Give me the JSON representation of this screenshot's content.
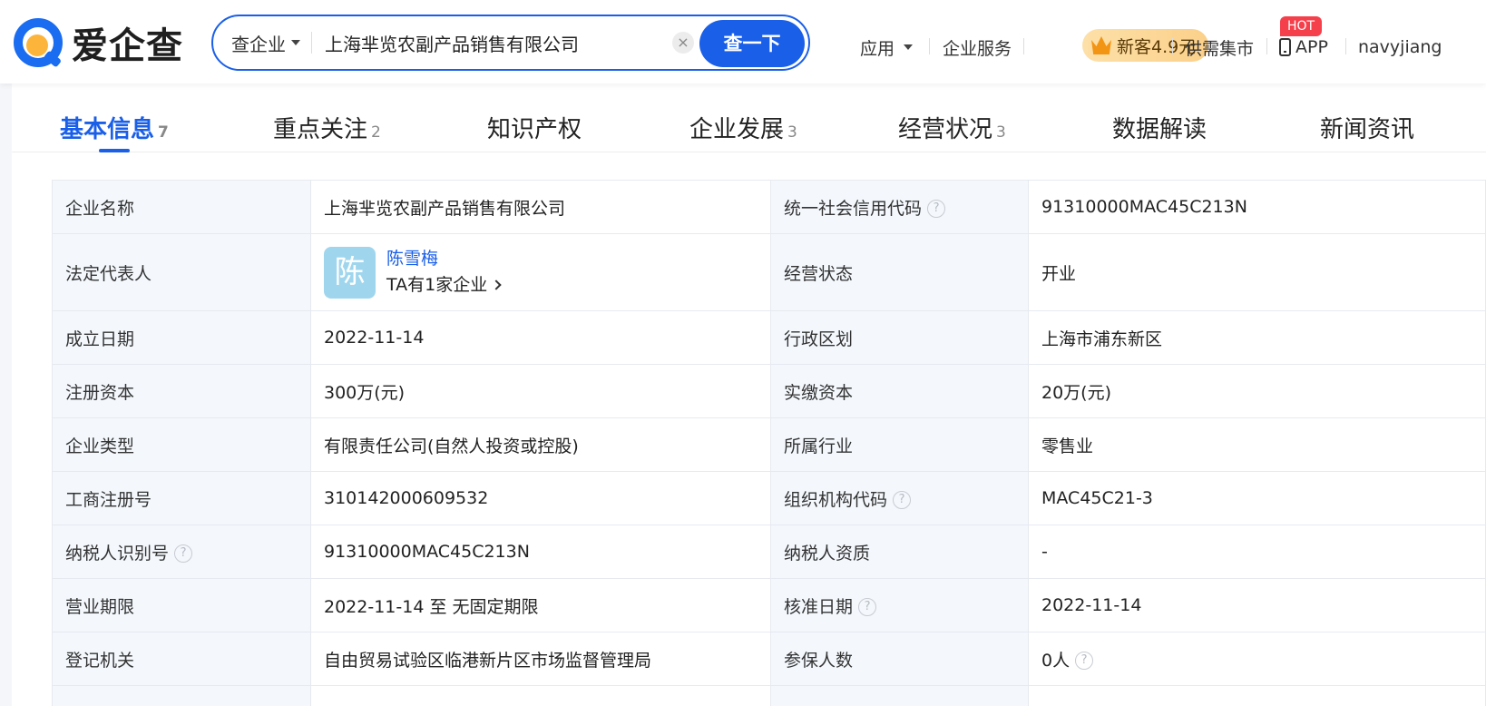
{
  "header": {
    "logo_text": "爱企查",
    "search": {
      "type_label": "查企业",
      "query": "上海芈览农副产品销售有限公司",
      "clear": "×",
      "button": "查一下"
    },
    "nav": {
      "apps": "应用",
      "enterprise_services": "企业服务",
      "vip_promo": "新客4.9元",
      "supply_market": "供需集市",
      "hot_badge": "HOT",
      "app": "APP",
      "user": "navyjiang"
    }
  },
  "tabs": [
    {
      "label": "基本信息",
      "count": "7",
      "active": true
    },
    {
      "label": "重点关注",
      "count": "2"
    },
    {
      "label": "知识产权",
      "count": ""
    },
    {
      "label": "企业发展",
      "count": "3"
    },
    {
      "label": "经营状况",
      "count": "3"
    },
    {
      "label": "数据解读",
      "count": ""
    },
    {
      "label": "新闻资讯",
      "count": ""
    }
  ],
  "info": {
    "company_name": {
      "label": "企业名称",
      "value": "上海芈览农副产品销售有限公司"
    },
    "credit_code": {
      "label": "统一社会信用代码",
      "value": "91310000MAC45C213N"
    },
    "legal_rep": {
      "label": "法定代表人",
      "avatar_char": "陈",
      "name": "陈雪梅",
      "companies": "TA有1家企业"
    },
    "status": {
      "label": "经营状态",
      "value": "开业"
    },
    "founded": {
      "label": "成立日期",
      "value": "2022-11-14"
    },
    "region": {
      "label": "行政区划",
      "value": "上海市浦东新区"
    },
    "reg_capital": {
      "label": "注册资本",
      "value": "300万(元)"
    },
    "paid_capital": {
      "label": "实缴资本",
      "value": "20万(元)"
    },
    "company_type": {
      "label": "企业类型",
      "value": "有限责任公司(自然人投资或控股)"
    },
    "industry": {
      "label": "所属行业",
      "value": "零售业"
    },
    "reg_number": {
      "label": "工商注册号",
      "value": "310142000609532"
    },
    "org_code": {
      "label": "组织机构代码",
      "value": "MAC45C21-3"
    },
    "taxpayer_id": {
      "label": "纳税人识别号",
      "value": "91310000MAC45C213N"
    },
    "taxpayer_qual": {
      "label": "纳税人资质",
      "value": "-"
    },
    "term": {
      "label": "营业期限",
      "value": "2022-11-14 至 无固定期限"
    },
    "approval_date": {
      "label": "核准日期",
      "value": "2022-11-14"
    },
    "authority": {
      "label": "登记机关",
      "value": "自由贸易试验区临港新片区市场监督管理局"
    },
    "insured": {
      "label": "参保人数",
      "value": "0人"
    }
  },
  "help_glyph": "?"
}
